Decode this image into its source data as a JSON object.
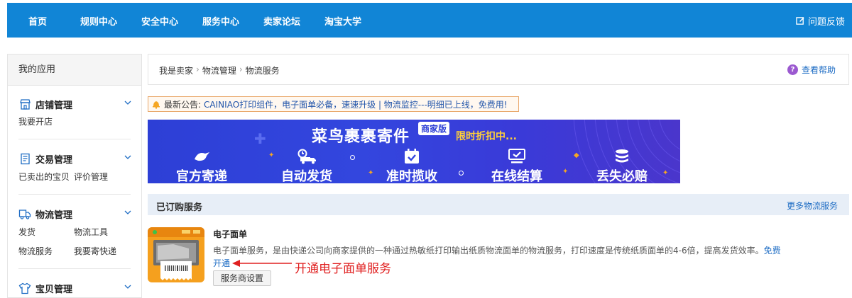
{
  "topnav": {
    "items": [
      "首页",
      "规则中心",
      "安全中心",
      "服务中心",
      "卖家论坛",
      "淘宝大学"
    ],
    "feedback": "问题反馈",
    "color": "#1185d6"
  },
  "sidebar": {
    "title": "我的应用",
    "groups": [
      {
        "name": "店铺管理",
        "icon": "shop-icon",
        "links": [
          "我要开店"
        ]
      },
      {
        "name": "交易管理",
        "icon": "document-icon",
        "links": [
          "已卖出的宝贝",
          "评价管理"
        ]
      },
      {
        "name": "物流管理",
        "icon": "truck-icon",
        "links": [
          "发货",
          "物流工具",
          "物流服务",
          "我要寄快递"
        ]
      },
      {
        "name": "宝贝管理",
        "icon": "shirt-icon",
        "links": []
      }
    ]
  },
  "breadcrumb": {
    "items": [
      "我是卖家",
      "物流管理",
      "物流服务"
    ],
    "help": "查看帮助"
  },
  "notice": {
    "label": "最新公告:",
    "text": "CAINIAO打印组件，电子面单必备，速速升级 | 物流监控---明细已上线，免费用!"
  },
  "banner": {
    "title": "菜鸟裹裹寄件",
    "tag": "商家版",
    "promo": "限时折扣中...",
    "features": [
      "官方寄递",
      "自动发货",
      "准时揽收",
      "在线结算",
      "丢失必赔"
    ]
  },
  "section": {
    "title": "已订购服务",
    "more": "更多物流服务"
  },
  "service": {
    "name": "电子面单",
    "desc": "电子面单服务，是由快递公司向商家提供的一种通过热敏纸打印输出纸质物流面单的物流服务，打印速度是传统纸质面单的4-6倍，提高发货效率。",
    "free": "免费",
    "open": "开通",
    "button": "服务商设置",
    "icon": "e-waybill-printer-icon"
  },
  "annotation": "开通电子面单服务"
}
